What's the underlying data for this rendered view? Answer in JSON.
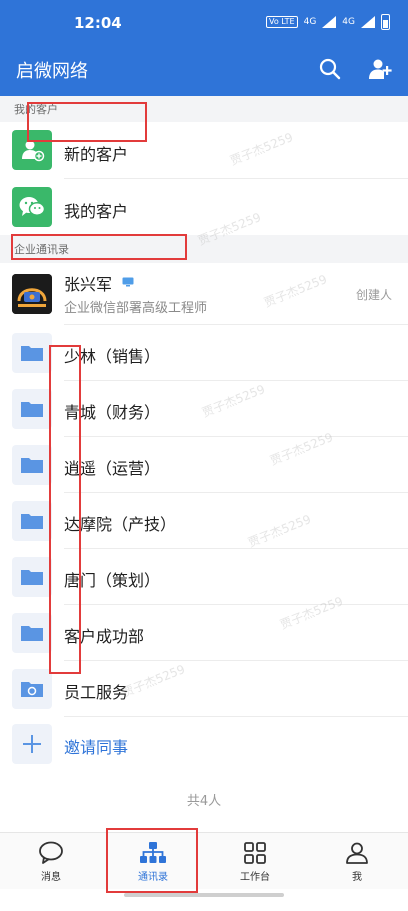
{
  "status_bar": {
    "time": "12:04",
    "volte": "Vo LTE",
    "net1": "4G",
    "net2": "4G"
  },
  "app_bar": {
    "title": "启微网络",
    "search_icon": "search-icon",
    "add_contact_icon": "add-user-icon"
  },
  "sections": {
    "my_customers": "我的客户",
    "company_directory": "企业通讯录"
  },
  "customer_items": [
    {
      "label": "新的客户",
      "icon": "new-customer-icon"
    },
    {
      "label": "我的客户",
      "icon": "wechat-icon"
    }
  ],
  "contact": {
    "name": "张兴军",
    "title": "企业微信部署高级工程师",
    "badge": "创建人"
  },
  "departments": [
    {
      "label": "少林（销售）"
    },
    {
      "label": "青城（财务）"
    },
    {
      "label": "逍遥（运营）"
    },
    {
      "label": "达摩院（产技）"
    },
    {
      "label": "唐门（策划）"
    },
    {
      "label": "客户成功部"
    }
  ],
  "employee_service": {
    "label": "员工服务"
  },
  "invite": {
    "label": "邀请同事"
  },
  "footer": {
    "count": "共4人"
  },
  "tabs": [
    {
      "label": "消息",
      "icon": "message-icon"
    },
    {
      "label": "通讯录",
      "icon": "contacts-icon",
      "active": true
    },
    {
      "label": "工作台",
      "icon": "workbench-icon"
    },
    {
      "label": "我",
      "icon": "profile-icon"
    }
  ],
  "watermark": "贾子杰5259",
  "colors": {
    "brand": "#2f74d8",
    "green": "#3ab86a",
    "highlight": "#e23b3b"
  }
}
